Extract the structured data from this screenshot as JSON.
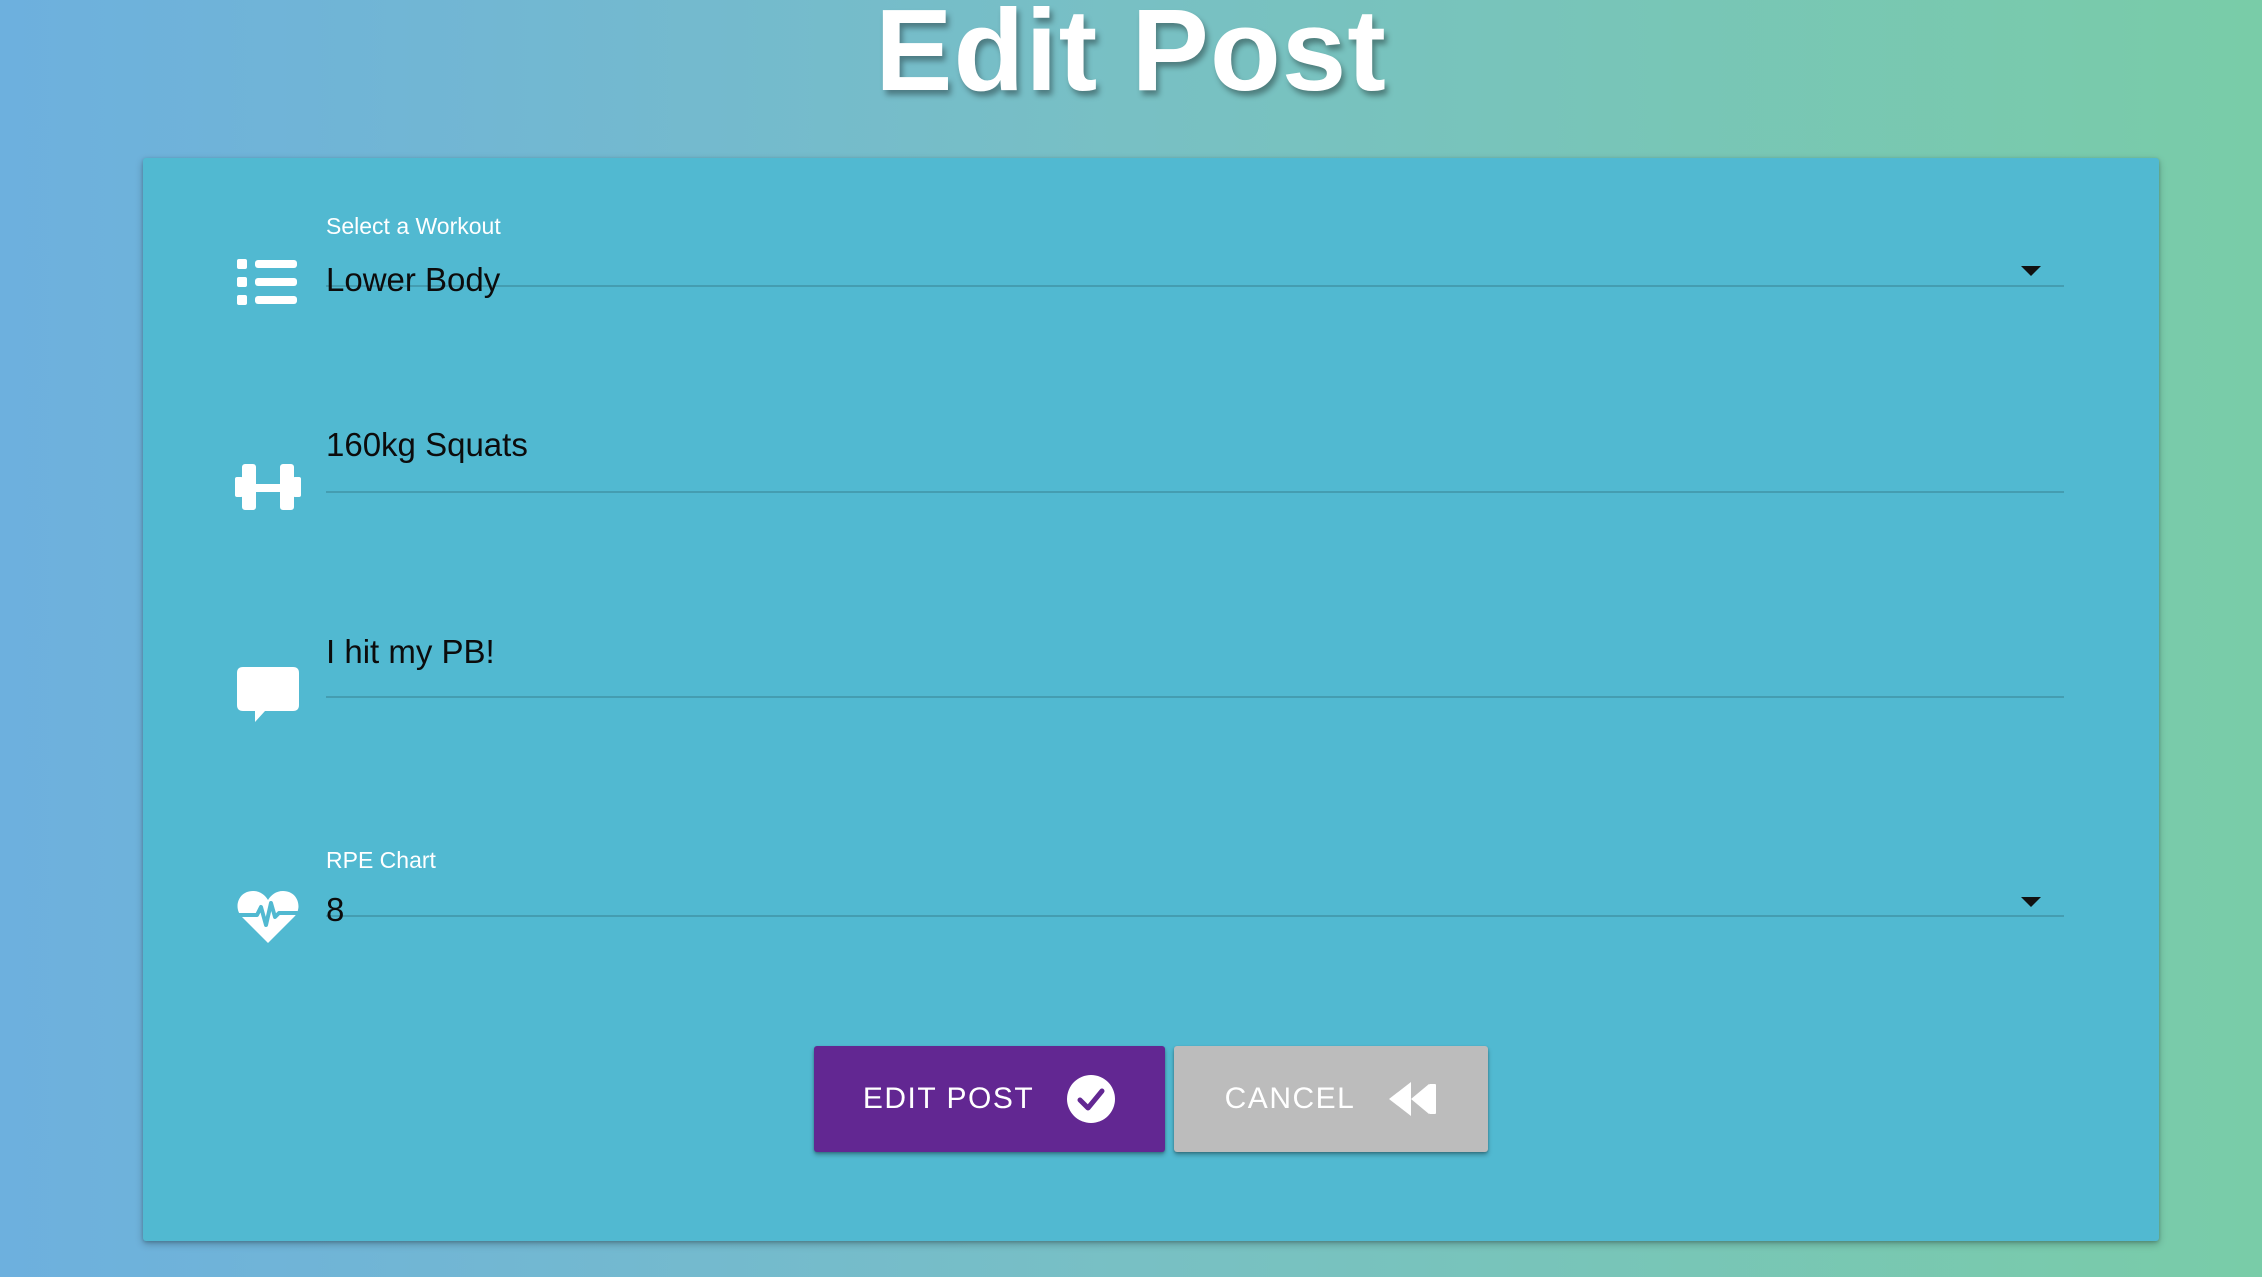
{
  "page": {
    "title": "Edit Post"
  },
  "form": {
    "workout": {
      "label": "Select a Workout",
      "value": "Lower Body",
      "icon": "list-icon"
    },
    "exercise": {
      "value": "160kg Squats",
      "icon": "dumbbell-icon"
    },
    "comment": {
      "value": "I hit my PB!",
      "icon": "speech-bubble-icon"
    },
    "rpe": {
      "label": "RPE Chart",
      "value": "8",
      "icon": "heartbeat-icon"
    }
  },
  "buttons": {
    "edit": {
      "label": "EDIT POST",
      "icon": "check-circle-icon"
    },
    "cancel": {
      "label": "CANCEL",
      "icon": "rewind-icon"
    }
  },
  "colors": {
    "card": "#51b9d1",
    "edit_button": "#622792",
    "cancel_button": "#bcbcbc"
  }
}
